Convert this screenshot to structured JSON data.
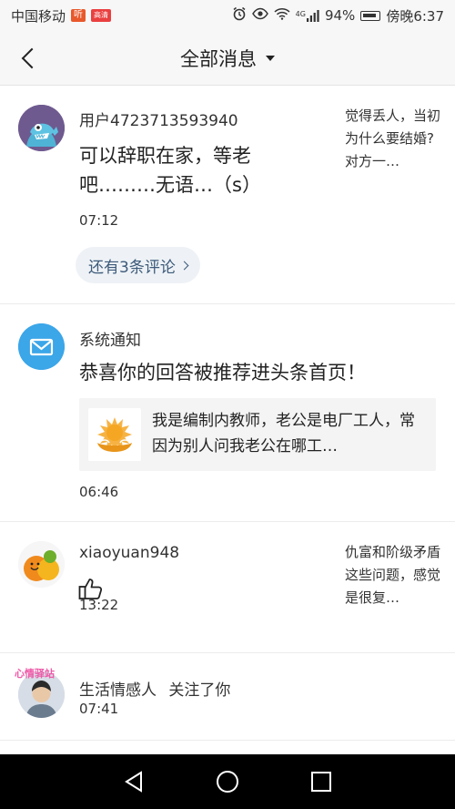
{
  "status_bar": {
    "carrier": "中国移动",
    "badge_1": "听",
    "badge_2": "高清",
    "network": "4G",
    "battery": "94%",
    "time": "傍晚6:37",
    "icons": [
      "alarm-icon",
      "eye-icon",
      "wifi-icon",
      "signal-icon",
      "battery-icon"
    ]
  },
  "header": {
    "title": "全部消息",
    "back_icon": "chevron-left-icon",
    "dropdown_icon": "caret-down-icon"
  },
  "messages": [
    {
      "username": "用户4723713593940",
      "body": "可以辞职在家，等老吧………无语…（s）",
      "time": "07:12",
      "snippet": "觉得丢人，当初为什么要结婚?对方一…",
      "more_comments": "还有3条评论"
    },
    {
      "username": "系统通知",
      "body": "恭喜你的回答被推荐进头条首页！",
      "quote": "我是编制内教师，老公是电厂工人，常因为别人问我老公在哪工…",
      "time": "06:46"
    },
    {
      "username": "xiaoyuan948",
      "time": "13:22",
      "snippet": "仇富和阶级矛盾这些问题，感觉是很复…"
    },
    {
      "username": "生活情感人",
      "action": "关注了你",
      "time": "07:41",
      "avatar_caption": "心情驿站"
    }
  ],
  "nav_bar": {
    "icons": [
      "back-triangle-icon",
      "home-circle-icon",
      "recent-square-icon"
    ]
  },
  "colors": {
    "header_bg": "#f7f7f7",
    "pill_bg": "#eef2f6",
    "pill_text": "#3d5a7a",
    "system_avatar": "#3ba6e8",
    "nav_bar": "#000000"
  }
}
